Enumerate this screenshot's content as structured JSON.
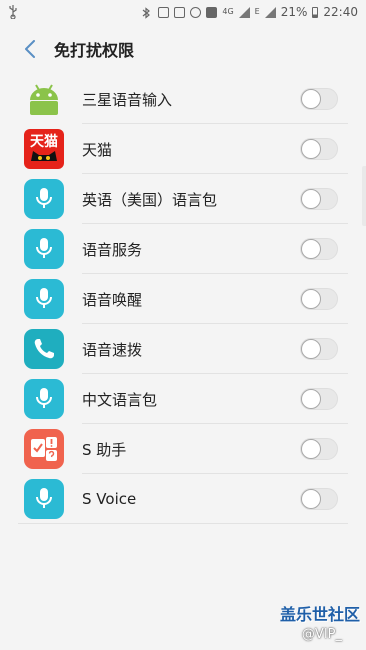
{
  "status_bar": {
    "network": "4G",
    "signal_label": "E",
    "battery": "21%",
    "time": "22:40"
  },
  "header": {
    "title": "免打扰权限"
  },
  "apps": [
    {
      "label": "三星语音输入",
      "icon": "android-icon",
      "enabled": false
    },
    {
      "label": "天猫",
      "icon": "tmall-icon",
      "icon_text": "天猫",
      "enabled": false
    },
    {
      "label": "英语（美国）语言包",
      "icon": "microphone-icon",
      "enabled": false
    },
    {
      "label": "语音服务",
      "icon": "microphone-icon",
      "enabled": false
    },
    {
      "label": "语音唤醒",
      "icon": "microphone-icon",
      "enabled": false
    },
    {
      "label": "语音速拨",
      "icon": "phone-icon",
      "enabled": false
    },
    {
      "label": "中文语言包",
      "icon": "microphone-icon",
      "enabled": false
    },
    {
      "label": "S 助手",
      "icon": "assistant-icon",
      "enabled": false
    },
    {
      "label": "S Voice",
      "icon": "microphone-icon",
      "enabled": false
    }
  ],
  "watermark": {
    "brand": "盖乐世社区",
    "user": "@VIP_"
  },
  "colors": {
    "accent_teal": "#2bbad4",
    "back_arrow": "#5a8fc4",
    "toggle_off": "#e8e8e8",
    "tmall_red": "#e5231a",
    "assistant_orange": "#f0634e"
  }
}
